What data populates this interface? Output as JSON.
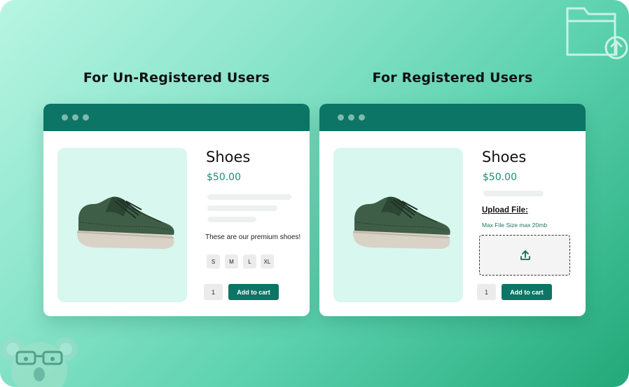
{
  "colors": {
    "titlebar": "#0d7565",
    "accent": "#1c8a72",
    "image_bg": "#d8f7ee",
    "button": "#0d7565"
  },
  "decorations": {
    "top_right_icon": "folder-upload-icon",
    "bottom_left_icon": "koala-mascot-icon"
  },
  "unregistered": {
    "heading": "For Un-Registered Users",
    "product": {
      "title": "Shoes",
      "price": "$50.00",
      "description": "These are our premium shoes!",
      "sizes": [
        "S",
        "M",
        "L",
        "XL"
      ],
      "quantity": "1",
      "add_to_cart": "Add to cart"
    }
  },
  "registered": {
    "heading": "For Registered Users",
    "product": {
      "title": "Shoes",
      "price": "$50.00",
      "upload_label": "Upload File:",
      "upload_hint": "Max File Size max 20mb",
      "quantity": "1",
      "add_to_cart": "Add to cart"
    }
  }
}
